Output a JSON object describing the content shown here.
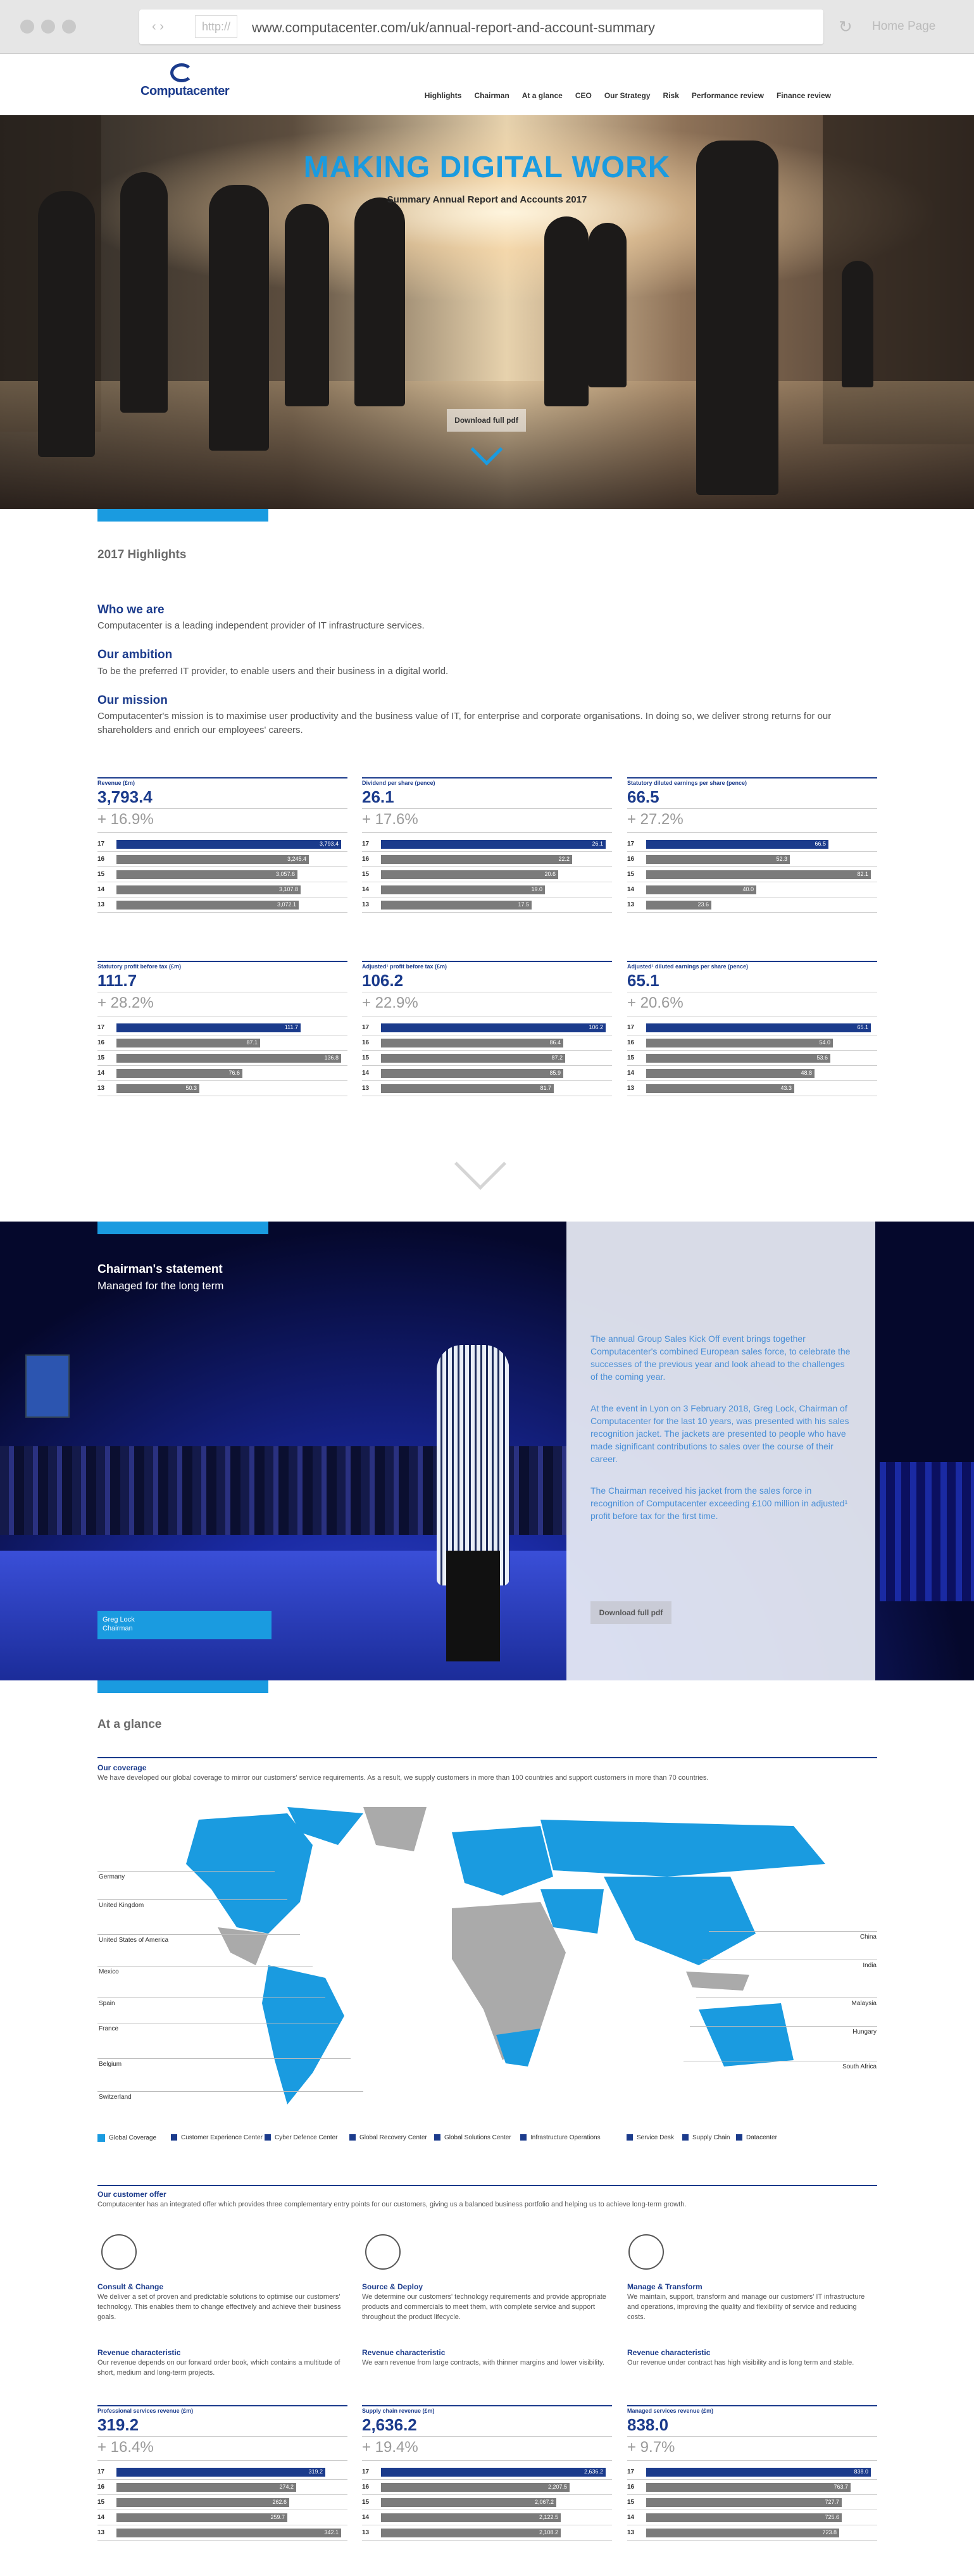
{
  "browser": {
    "proto": "http://",
    "url": "www.computacenter.com/uk/annual-report-and-account-summary",
    "home": "Home Page"
  },
  "header": {
    "logo": "Computacenter",
    "nav": [
      "Highlights",
      "Chairman",
      "At a glance",
      "CEO",
      "Our Strategy",
      "Risk",
      "Performance review",
      "Finance review"
    ]
  },
  "hero": {
    "title": "MAKING DIGITAL WORK",
    "subtitle": "Summary Annual Report and Accounts 2017",
    "download": "Download full pdf"
  },
  "highlights": {
    "title": "2017 Highlights",
    "who_h": "Who we are",
    "who_p": "Computacenter is a leading independent provider of IT infrastructure services.",
    "ambition_h": "Our ambition",
    "ambition_p": "To be the preferred IT provider, to enable users and their business in a digital world.",
    "mission_h": "Our mission",
    "mission_p1": "Computacenter's mission is to maximise user productivity and the business value of IT, for enterprise and corporate organisations. In doing so, we deliver strong returns for our",
    "mission_p2": "shareholders and enrich our employees' careers."
  },
  "kpis": [
    {
      "label": "Revenue (£m)",
      "value": "3,793.4",
      "change": "+ 16.9%",
      "rows": [
        {
          "y": "17",
          "v": "3,793.4",
          "f": 1.0
        },
        {
          "y": "16",
          "v": "3,245.4",
          "f": 0.856
        },
        {
          "y": "15",
          "v": "3,057.6",
          "f": 0.806
        },
        {
          "y": "14",
          "v": "3,107.8",
          "f": 0.819
        },
        {
          "y": "13",
          "v": "3,072.1",
          "f": 0.81
        }
      ]
    },
    {
      "label": "Dividend per share (pence)",
      "value": "26.1",
      "change": "+ 17.6%",
      "rows": [
        {
          "y": "17",
          "v": "26.1",
          "f": 1.0
        },
        {
          "y": "16",
          "v": "22.2",
          "f": 0.85
        },
        {
          "y": "15",
          "v": "20.6",
          "f": 0.79
        },
        {
          "y": "14",
          "v": "19.0",
          "f": 0.73
        },
        {
          "y": "13",
          "v": "17.5",
          "f": 0.67
        }
      ]
    },
    {
      "label": "Statutory diluted earnings per share (pence)",
      "value": "66.5",
      "change": "+ 27.2%",
      "rows": [
        {
          "y": "17",
          "v": "66.5",
          "f": 0.81
        },
        {
          "y": "16",
          "v": "52.3",
          "f": 0.64
        },
        {
          "y": "15",
          "v": "82.1",
          "f": 1.0
        },
        {
          "y": "14",
          "v": "40.0",
          "f": 0.49
        },
        {
          "y": "13",
          "v": "23.6",
          "f": 0.29
        }
      ]
    },
    {
      "label": "Statutory profit before tax (£m)",
      "value": "111.7",
      "change": "+ 28.2%",
      "rows": [
        {
          "y": "17",
          "v": "111.7",
          "f": 0.82
        },
        {
          "y": "16",
          "v": "87.1",
          "f": 0.64
        },
        {
          "y": "15",
          "v": "136.8",
          "f": 1.0
        },
        {
          "y": "14",
          "v": "76.6",
          "f": 0.56
        },
        {
          "y": "13",
          "v": "50.3",
          "f": 0.37
        }
      ]
    },
    {
      "label": "Adjusted¹ profit before tax (£m)",
      "value": "106.2",
      "change": "+ 22.9%",
      "rows": [
        {
          "y": "17",
          "v": "106.2",
          "f": 1.0
        },
        {
          "y": "16",
          "v": "86.4",
          "f": 0.81
        },
        {
          "y": "15",
          "v": "87.2",
          "f": 0.82
        },
        {
          "y": "14",
          "v": "85.9",
          "f": 0.81
        },
        {
          "y": "13",
          "v": "81.7",
          "f": 0.77
        }
      ]
    },
    {
      "label": "Adjusted¹ diluted earnings per share (pence)",
      "value": "65.1",
      "change": "+ 20.6%",
      "rows": [
        {
          "y": "17",
          "v": "65.1",
          "f": 1.0
        },
        {
          "y": "16",
          "v": "54.0",
          "f": 0.83
        },
        {
          "y": "15",
          "v": "53.6",
          "f": 0.82
        },
        {
          "y": "14",
          "v": "48.8",
          "f": 0.75
        },
        {
          "y": "13",
          "v": "43.3",
          "f": 0.66
        }
      ]
    }
  ],
  "chairman": {
    "title": "Chairman's statement",
    "subtitle": "Managed for the long term",
    "caption1": "Greg Lock",
    "caption2": "Chairman",
    "p1": "The annual Group Sales Kick Off event brings together Computacenter's combined European sales force, to celebrate the successes of the previous year and look ahead to the challenges of the coming year.",
    "p2": "At the event in Lyon on 3 February 2018, Greg Lock, Chairman of Computacenter for the last 10 years, was presented with his sales recognition jacket. The jackets are presented to people who have made significant contributions to sales over the course of their career.",
    "p3": "The Chairman received his jacket from the sales force in recognition of Computacenter exceeding £100 million in adjusted¹ profit before tax for the first time.",
    "download": "Download full pdf"
  },
  "glance": {
    "title": "At a glance",
    "coverage_h": "Our coverage",
    "coverage_p": "We have developed our global coverage to mirror our customers' service requirements. As a result, we supply customers in more than 100 countries and support customers in more than 70 countries.",
    "countries_left": [
      "Germany",
      "United Kingdom",
      "United States of America",
      "Mexico",
      "Spain",
      "France",
      "Belgium",
      "Switzerland"
    ],
    "countries_right": [
      "China",
      "India",
      "Malaysia",
      "Hungary",
      "South Africa"
    ],
    "legend": [
      "Global Coverage",
      "Customer Experience Center",
      "Cyber Defence Center",
      "Global Recovery Center",
      "Global Solutions Center",
      "Infrastructure Operations",
      "Service Desk",
      "Supply Chain",
      "Datacenter"
    ]
  },
  "offer": {
    "title": "Our customer offer",
    "intro": "Computacenter has an integrated offer which provides three complementary entry points for our customers, giving us a balanced business portfolio and helping us to achieve long-term growth.",
    "cols": [
      {
        "h": "Consult & Change",
        "p": "We deliver a set of proven and predictable solutions to optimise our customers' technology. This enables them to change effectively and achieve their business goals.",
        "rh": "Revenue characteristic",
        "rp": "Our revenue depends on our forward order book, which contains a multitude of short, medium and long-term projects."
      },
      {
        "h": "Source & Deploy",
        "p": "We determine our customers' technology requirements and provide appropriate products and commercials to meet them, with complete service and support throughout the product lifecycle.",
        "rh": "Revenue characteristic",
        "rp": "We earn revenue from large contracts, with thinner margins and lower visibility."
      },
      {
        "h": "Manage & Transform",
        "p": "We maintain, support, transform and manage our customers' IT infrastructure and operations, improving the quality and flexibility of service and reducing costs.",
        "rh": "Revenue characteristic",
        "rp": "Our revenue under contract has high visibility and is long term and stable."
      }
    ]
  },
  "kpis2": [
    {
      "label": "Professional services revenue (£m)",
      "value": "319.2",
      "change": "+ 16.4%",
      "rows": [
        {
          "y": "17",
          "v": "319.2",
          "f": 0.93
        },
        {
          "y": "16",
          "v": "274.2",
          "f": 0.8
        },
        {
          "y": "15",
          "v": "262.6",
          "f": 0.77
        },
        {
          "y": "14",
          "v": "259.7",
          "f": 0.76
        },
        {
          "y": "13",
          "v": "342.1",
          "f": 1.0
        }
      ]
    },
    {
      "label": "Supply chain revenue (£m)",
      "value": "2,636.2",
      "change": "+ 19.4%",
      "rows": [
        {
          "y": "17",
          "v": "2,636.2",
          "f": 1.0
        },
        {
          "y": "16",
          "v": "2,207.5",
          "f": 0.84
        },
        {
          "y": "15",
          "v": "2,067.2",
          "f": 0.78
        },
        {
          "y": "14",
          "v": "2,122.5",
          "f": 0.8
        },
        {
          "y": "13",
          "v": "2,108.2",
          "f": 0.8
        }
      ]
    },
    {
      "label": "Managed services revenue (£m)",
      "value": "838.0",
      "change": "+ 9.7%",
      "rows": [
        {
          "y": "17",
          "v": "838.0",
          "f": 1.0
        },
        {
          "y": "16",
          "v": "763.7",
          "f": 0.91
        },
        {
          "y": "15",
          "v": "727.7",
          "f": 0.87
        },
        {
          "y": "14",
          "v": "725.6",
          "f": 0.87
        },
        {
          "y": "13",
          "v": "723.8",
          "f": 0.86
        }
      ]
    }
  ],
  "colors": {
    "blue": "#1a9be0",
    "navy": "#1b3b8c"
  }
}
